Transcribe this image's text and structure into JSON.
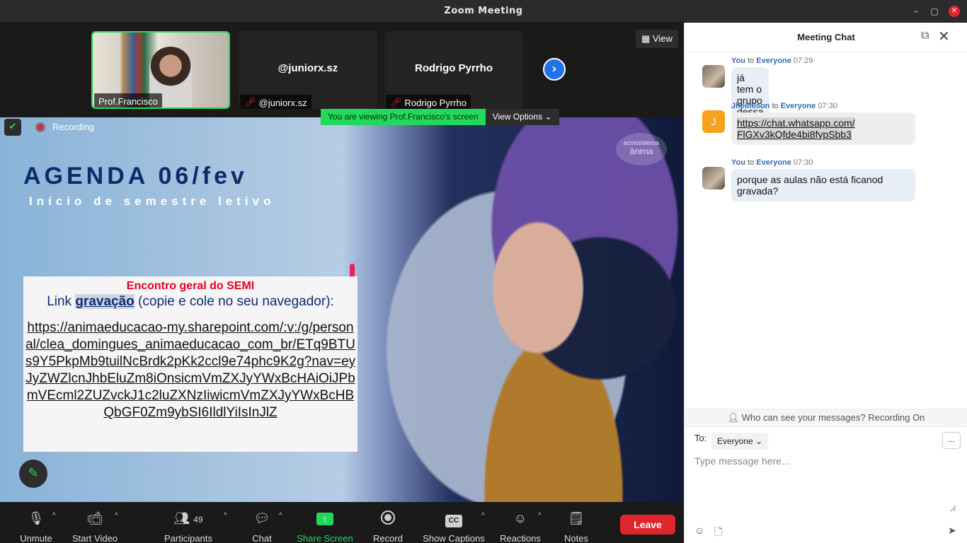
{
  "window": {
    "title": "Zoom Meeting"
  },
  "thumbnails": [
    {
      "name": "Prof.Francisco",
      "muted": false,
      "active": true
    },
    {
      "name": "@juniorx.sz",
      "display": "@juniorx.sz",
      "muted": true
    },
    {
      "name": "Rodrigo Pyrrho",
      "display": "Rodrigo Pyrrho",
      "muted": true
    }
  ],
  "view_button": "View",
  "recording_label": "Recording",
  "viewing_banner": "You are viewing Prof.Francisco's screen",
  "view_options": "View Options",
  "slide": {
    "title": "AGENDA 06/fev",
    "subtitle": "Início de semestre letivo",
    "box_heading": "Encontro geral do SEMI",
    "link_prefix": "Link",
    "link_highlight": "gravação",
    "link_suffix": "(copie e cole no seu navegador):",
    "url": "https://animaeducacao-my.sharepoint.com/:v:/g/personal/clea_domingues_animaeducacao_com_br/ETq9BTUs9Y5PkpMb9tuilNcBrdk2pKk2ccl9e74phc9K2g?nav=eyJyZWZlcnJhbEluZm8iOnsicmVmZXJyYWxBcHAiOiJPbmVEcml2ZUZvckJ1c2luZXNzIiwicmVmZXJyYWxBcHBQbGF0Zm9ybSI6IldlYiIsInJlZ",
    "logo_line1": "ecossistema",
    "logo_line2": "ânima"
  },
  "toolbar": {
    "unmute": "Unmute",
    "start_video": "Start Video",
    "participants": "Participants",
    "participants_count": "49",
    "chat": "Chat",
    "share_screen": "Share Screen",
    "record": "Record",
    "show_captions": "Show Captions",
    "reactions": "Reactions",
    "notes": "Notes",
    "leave": "Leave"
  },
  "chat": {
    "title": "Meeting Chat",
    "messages": [
      {
        "from": "You",
        "to_word": "to",
        "to": "Everyone",
        "time": "07:29",
        "text": "já tem o grupo dessa uc?"
      },
      {
        "from": "Jheimison",
        "to_word": "to",
        "to": "Everyone",
        "time": "07:30",
        "initial": "J",
        "text_line1": "https://chat.whatsapp.com/",
        "text_line2": "FlGXv3kQfde4bi8fypSbb3"
      },
      {
        "from": "You",
        "to_word": "to",
        "to": "Everyone",
        "time": "07:30",
        "text": "porque as aulas não está ficanod gravada?"
      }
    ],
    "who_can_see": "Who can see your messages? Recording On",
    "to_label": "To:",
    "to_value": "Everyone",
    "more": "...",
    "placeholder": "Type message here..."
  },
  "colors": {
    "accent_green": "#23d959",
    "leave_red": "#e0262d",
    "link_blue": "#3a6ab0"
  }
}
